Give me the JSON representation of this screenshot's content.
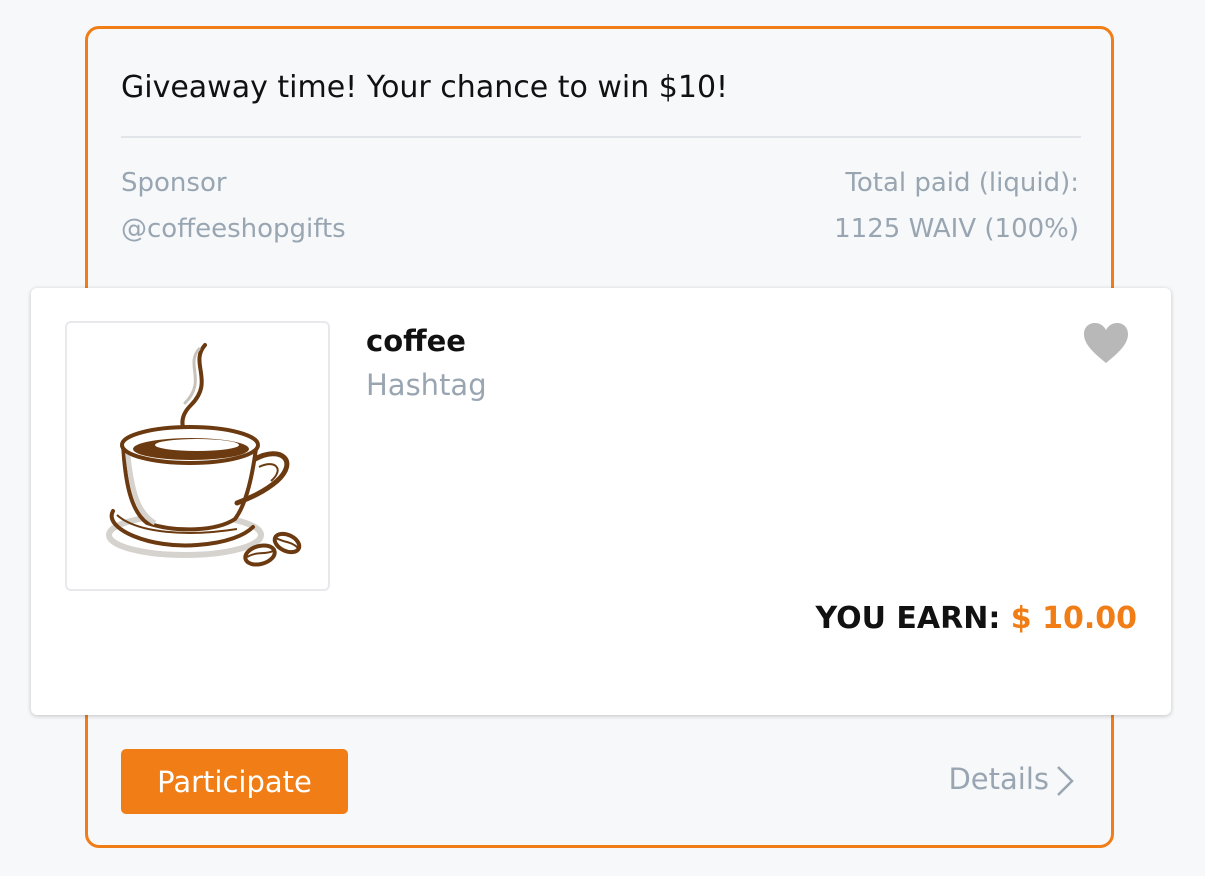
{
  "campaign": {
    "title": "Giveaway time! Your chance to win $10!",
    "sponsor_label": "Sponsor",
    "sponsor_name": "@coffeeshopgifts",
    "total_paid_label": "Total paid (liquid):",
    "total_paid_value": "1125 WAIV (100%)"
  },
  "object": {
    "name": "coffee",
    "type": "Hashtag",
    "image_icon": "coffee-cup-icon",
    "favorite_icon": "heart-icon",
    "earn_label": "YOU EARN:",
    "earn_value": "$ 10.00"
  },
  "actions": {
    "participate_label": "Participate",
    "details_label": "Details",
    "details_icon": "chevron-right-icon"
  },
  "colors": {
    "accent": "#f17d17",
    "muted_text": "#99a6b2",
    "heart": "#b8b8b8",
    "coffee_brown": "#6b3a10"
  }
}
